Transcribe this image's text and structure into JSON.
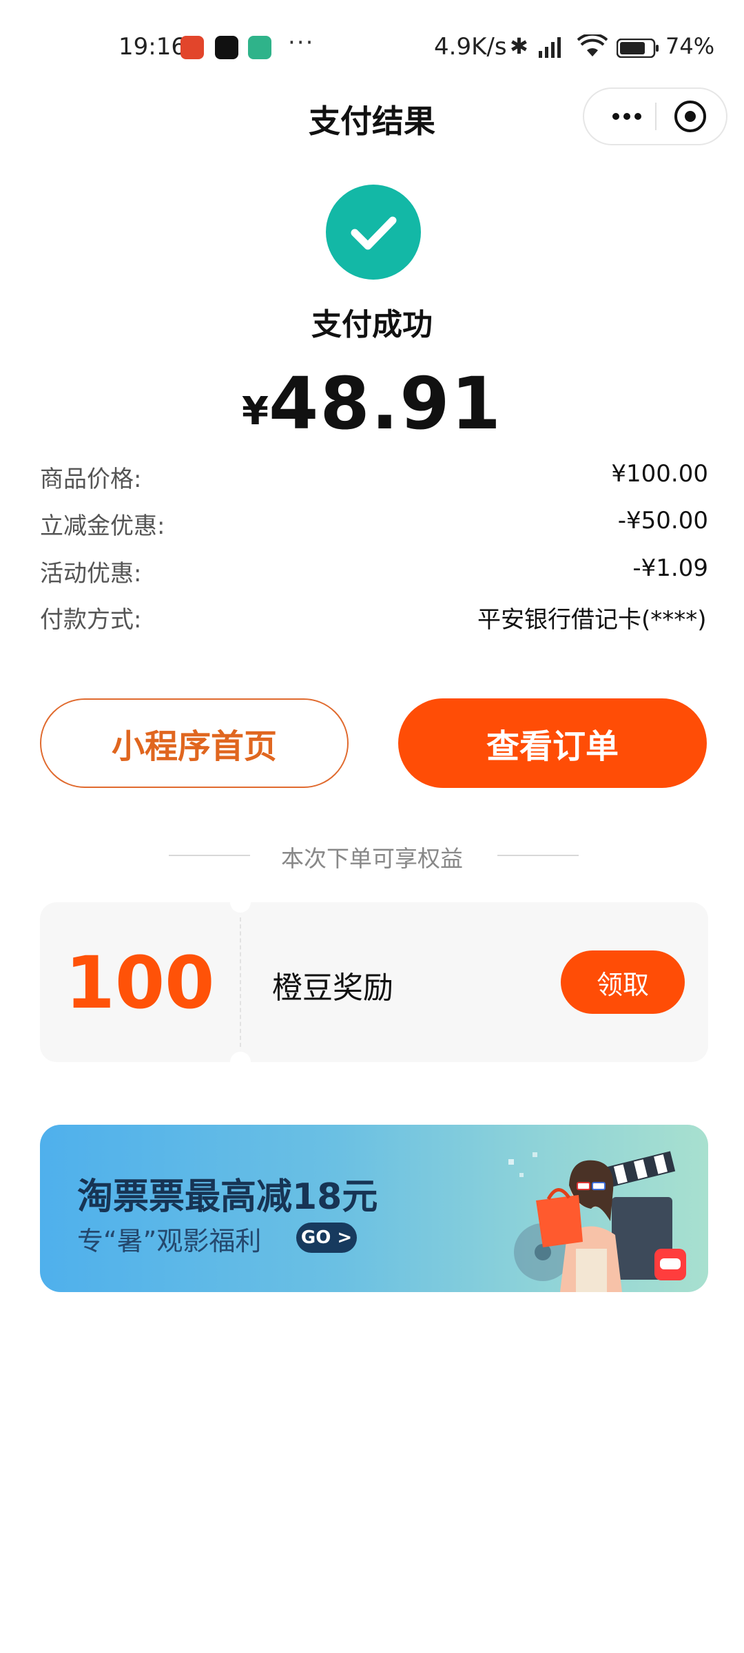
{
  "status_bar": {
    "time": "19:16",
    "more_dots": "···",
    "net_speed": "4.9K/s",
    "bluetooth_glyph": "✱",
    "battery": "74%"
  },
  "nav": {
    "title": "支付结果",
    "more_icon": "more-dots-icon",
    "close_icon": "miniprogram-close-icon"
  },
  "result": {
    "status_text": "支付成功",
    "currency": "¥",
    "amount": "48.91",
    "icon": "check-circle-icon",
    "color": "#13b8a6"
  },
  "details": [
    {
      "label": "商品价格:",
      "value": "¥100.00"
    },
    {
      "label": "立减金优惠:",
      "value": "-¥50.00"
    },
    {
      "label": "活动优惠:",
      "value": "-¥1.09"
    },
    {
      "label": "付款方式:",
      "value": "平安银行借记卡(****)"
    }
  ],
  "buttons": {
    "home": "小程序首页",
    "order": "查看订单",
    "accent": "#ff4d06"
  },
  "benefits": {
    "divider_text": "本次下单可享权益",
    "reward_amount": "100",
    "reward_label": "橙豆奖励",
    "claim_label": "领取"
  },
  "banner": {
    "title": "淘票票最高减18元",
    "subtitle": "专“暑”观影福利",
    "go_label": "GO >"
  }
}
